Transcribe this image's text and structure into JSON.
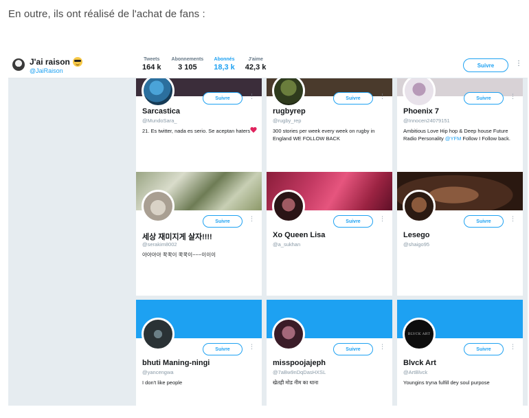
{
  "intro_text": "En outre, ils ont réalisé de l'achat de fans :",
  "profile": {
    "name": "J'ai raison",
    "handle": "@JaiRaison"
  },
  "stats": [
    {
      "label": "Tweets",
      "value": "164 k"
    },
    {
      "label": "Abonnements",
      "value": "3 105"
    },
    {
      "label": "Abonnés",
      "value": "18,3 k"
    },
    {
      "label": "J'aime",
      "value": "42,3 k"
    }
  ],
  "follow_label": "Suivre",
  "accent_color": "#1da1f2",
  "cards": [
    {
      "name": "Sarcastica",
      "handle": "@MundoSara_",
      "bio": "21. Es twitter, nada es serio. Se aceptan haters",
      "follow": "Suivre"
    },
    {
      "name": "rugbyrep",
      "handle": "@rugby_rep",
      "bio": "300 stories per week every week on rugby in England WE FOLLOW BACK",
      "follow": "Suivre"
    },
    {
      "name": "Phoenix 7",
      "handle": "@Innocen24079151",
      "bio_pre": "Ambitious Love Hip hop & Deep house Future Radio Personality ",
      "bio_link": "@YFM",
      "bio_post": " Follow I Follow back.",
      "follow": "Suivre"
    },
    {
      "name": "세상 재미지게 살자!!!!",
      "handle": "@serakim8002",
      "bio": "아아아아 꾹꾹이 꾹꾹이~~~이이이",
      "follow": "Suivre"
    },
    {
      "name": "Xo Queen Lisa",
      "handle": "@a_sukhan",
      "bio": "",
      "follow": "Suivre"
    },
    {
      "name": "Lesego",
      "handle": "@shaigo95",
      "bio": "",
      "follow": "Suivre"
    },
    {
      "name": "bhuti Maning-ningi",
      "handle": "@yancengwa",
      "bio": "I don't like people",
      "follow": "Suivre"
    },
    {
      "name": "misspoojajeph",
      "handle": "@7aBw9nDqDasHXSL",
      "bio": "खेतही मोड नीम का थाना",
      "follow": "Suivre"
    },
    {
      "name": "Blvck Art",
      "handle": "@ArtBlvck",
      "bio": "Youngins tryna fulfill dey soul purpose",
      "avatar_text": "BLVCK ART",
      "follow": "Suivre"
    }
  ]
}
